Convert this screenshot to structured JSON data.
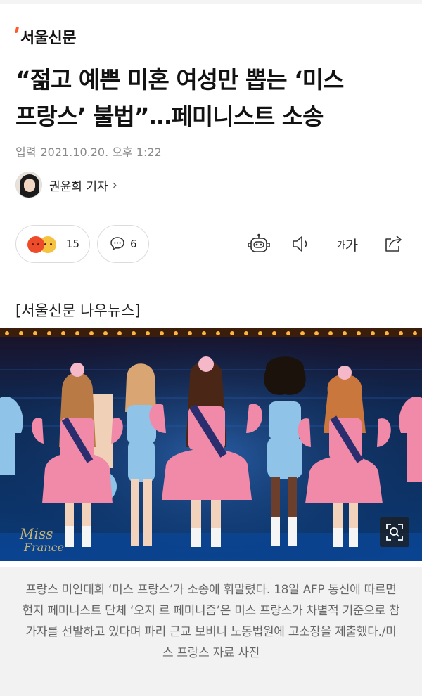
{
  "publisher": {
    "name": "서울신문"
  },
  "article": {
    "headline_line1": "“젊고 예쁜 미혼 여성만 뽑는 ‘미스",
    "headline_line2": "프랑스’ 불법”…페미니스트 소송",
    "date_label": "입력",
    "date_value": "2021.10.20. 오후 1:22",
    "author": "권윤희 기자",
    "author_chevron": "›",
    "source_tag": "[서울신문 나우뉴스]",
    "photo_caption": "프랑스 미인대회 ‘미스 프랑스’가 소송에 휘말렸다. 18일 AFP 통신에 따르면 현지 페미니스트 단체 ‘오지 르 페미니즘’은 미스 프랑스가 차별적 기준으로 참가자를 선발하고 있다며 파리 근교 보비니 노동법원에 고소장을 제출했다./미스 프랑스 자료 사진"
  },
  "engagement": {
    "reactions_count": "15",
    "comments_count": "6",
    "reaction_icons": [
      "angry-emoji-icon",
      "sad-emoji-icon"
    ]
  },
  "toolbar": {
    "robot_icon": "robot-icon",
    "speaker_icon": "speaker-icon",
    "font_small": "가",
    "font_large": "가",
    "share_icon": "share-icon"
  },
  "colors": {
    "brand_accent": "#ff5a2a",
    "stage_bg": "#0d1d3a",
    "costume_pink": "#f08aa8",
    "costume_blue": "#8fc4e8"
  }
}
